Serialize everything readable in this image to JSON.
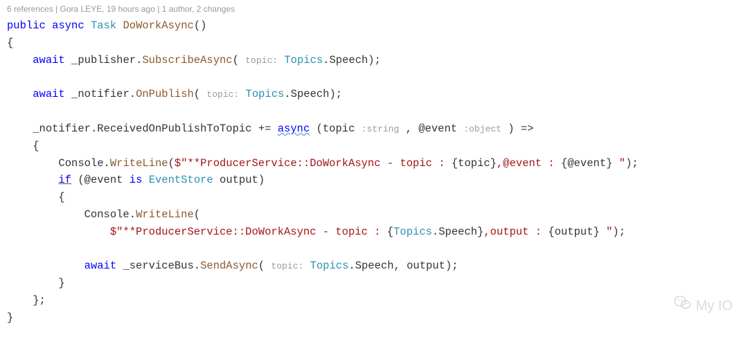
{
  "codelens": "6 references | Gora LEYE, 19 hours ago | 1 author, 2 changes",
  "kw": {
    "public": "public",
    "async": "async",
    "await": "await",
    "if": "if",
    "is": "is"
  },
  "types": {
    "task": "Task",
    "topics": "Topics",
    "eventstore": "EventStore"
  },
  "hints": {
    "topic": "topic:",
    "string": ":string",
    "object": ":object"
  },
  "members": {
    "speech": "Speech"
  },
  "fields": {
    "publisher": "_publisher",
    "notifier": "_notifier",
    "servicebus": "_serviceBus"
  },
  "methods": {
    "dowork": "DoWorkAsync",
    "subscribe": "SubscribeAsync",
    "onpublish": "OnPublish",
    "received": "ReceivedOnPublishToTopic",
    "writeline": "WriteLine",
    "sendasync": "SendAsync"
  },
  "console": "Console",
  "vars": {
    "topic": "topic",
    "atevent": "@event",
    "output": "output"
  },
  "strings": {
    "s1a": "$\"**ProducerService::DoWorkAsync - topic : ",
    "s1b": ",@event : ",
    "s1c": " \"",
    "s2a": "$\"**ProducerService::DoWorkAsync - topic : ",
    "s2b": ",output : ",
    "s2c": " \""
  },
  "punct": {
    "openparen": "(",
    "closeparen": ")",
    "openbrace": "{",
    "closebrace": "}",
    "dot": ".",
    "semi": ";",
    "comma": ",",
    "pluseq": "+=",
    "arrow": "=>",
    "sbopen": "{",
    "sbclose": "}"
  },
  "watermark": "My IO"
}
